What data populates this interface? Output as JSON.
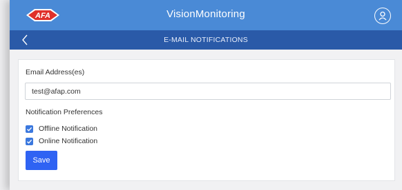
{
  "header": {
    "logo_text": "AFA",
    "app_title": "VisionMonitoring",
    "user_icon": "user-icon"
  },
  "subheader": {
    "back_icon": "chevron-left-icon",
    "title": "E-MAIL NOTIFICATIONS"
  },
  "form": {
    "email_label": "Email Address(es)",
    "email_value": "test@afap.com",
    "preferences_label": "Notification Preferences",
    "options": [
      {
        "label": "Offline Notification",
        "checked": true
      },
      {
        "label": "Online Notification",
        "checked": true
      }
    ],
    "save_label": "Save"
  },
  "colors": {
    "topbar": "#4a8ad6",
    "subbar": "#2a5aa8",
    "accent": "#2f63f3",
    "logo_red": "#e0302a"
  }
}
